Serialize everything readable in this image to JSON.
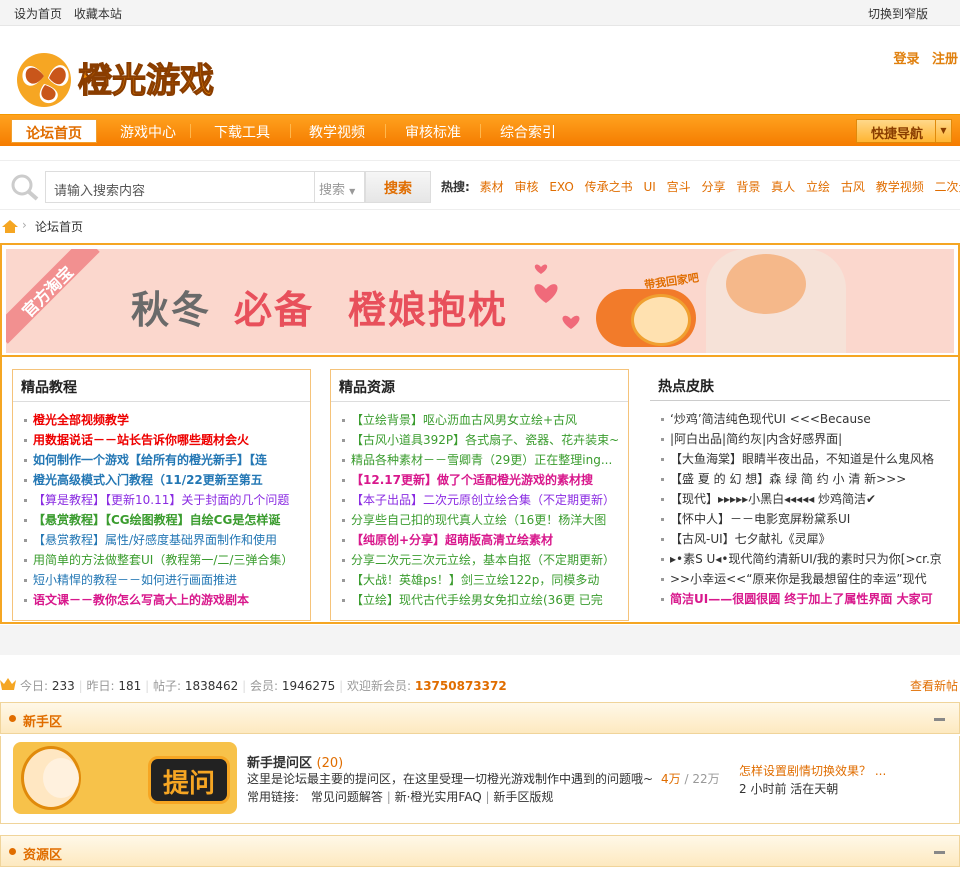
{
  "topbar": {
    "set_home": "设为首页",
    "bookmark": "收藏本站",
    "switch": "切换到窄版"
  },
  "header": {
    "logo_text": "橙光游戏",
    "login": "登录",
    "register": "注册"
  },
  "nav": {
    "items": [
      "论坛首页",
      "游戏中心",
      "下载工具",
      "教学视频",
      "审核标准",
      "综合索引"
    ],
    "quick_nav": "快捷导航"
  },
  "search": {
    "placeholder": "请输入搜索内容",
    "scope": "搜索",
    "button": "搜索",
    "hot_label": "热搜:",
    "hot": [
      "素材",
      "审核",
      "EXO",
      "传承之书",
      "UI",
      "宫斗",
      "分享",
      "背景",
      "真人",
      "立绘",
      "古风",
      "教学视频",
      "二次元"
    ]
  },
  "breadcrumb": {
    "current": "论坛首页"
  },
  "banner": {
    "ribbon": "官方淘宝",
    "text1": "秋冬",
    "text2": "必备",
    "text3": "橙娘抱枕",
    "tag": "带我回家吧"
  },
  "columns": {
    "tutorials": {
      "title": "精品教程",
      "items": [
        {
          "text": "橙光全部视频教学",
          "style": "c-red"
        },
        {
          "text": "用数据说话－－站长告诉你哪些题材会火",
          "style": "c-red"
        },
        {
          "text": "如何制作一个游戏【给所有的橙光新手】【连",
          "style": "c-blueb"
        },
        {
          "text": "橙光高级模式入门教程（11/22更新至第五",
          "style": "c-blueb"
        },
        {
          "text": "【算是教程】【更新10.11】关于封面的几个问题",
          "style": "c-purple"
        },
        {
          "text": "【悬赏教程】【CG绘图教程】自绘CG是怎样诞",
          "style": "c-greenb"
        },
        {
          "text": "【悬赏教程】属性/好感度基础界面制作和使用",
          "style": "c-blue"
        },
        {
          "text": "用简单的方法做整套UI（教程第一/二/三弹合集）",
          "style": "c-green"
        },
        {
          "text": "短小精悍的教程－－如何进行画面推进",
          "style": "c-blue"
        },
        {
          "text": "语文课－－教你怎么写高大上的游戏剧本",
          "style": "c-pink"
        }
      ]
    },
    "resources": {
      "title": "精品资源",
      "items": [
        {
          "text": "【立绘背景】呕心沥血古风男女立绘+古风",
          "style": "c-green"
        },
        {
          "text": "【古风小道具392P】各式扇子、瓷器、花卉装束~",
          "style": "c-green"
        },
        {
          "text": "精品各种素材－－雪卿青（29更）正在整理ing...",
          "style": "c-green"
        },
        {
          "text": "【12.17更新】做了个适配橙光游戏的素材搜",
          "style": "c-pink"
        },
        {
          "text": "【本子出品】二次元原创立绘合集（不定期更新）",
          "style": "c-purple"
        },
        {
          "text": "分享些自己扣的现代真人立绘（16更！杨洋大图",
          "style": "c-green"
        },
        {
          "text": "【纯原创+分享】超萌版高清立绘素材",
          "style": "c-pink"
        },
        {
          "text": "分享二次元三次元立绘，基本自抠（不定期更新）",
          "style": "c-green"
        },
        {
          "text": "【大战！英雄ps！】剑三立绘122p，同模多动",
          "style": "c-green"
        },
        {
          "text": "【立绘】现代古代手绘男女免扣立绘(36更 已完",
          "style": "c-green"
        }
      ]
    },
    "skins": {
      "title": "热点皮肤",
      "items": [
        {
          "text": "‘炒鸡’简洁纯色现代UI <<<Because",
          "style": "c-dark"
        },
        {
          "text": "|阿白出品|简约灰|内含好感界面|",
          "style": "c-dark"
        },
        {
          "text": "【大鱼海棠】眼睛半夜出品，不知道是什么鬼风格",
          "style": "c-dark"
        },
        {
          "text": "【盛 夏 的 幻 想】森 绿 简 约 小 清 新>>>",
          "style": "c-dark"
        },
        {
          "text": "【现代】▸▸▸▸▸小黑白◂◂◂◂◂ 炒鸡简洁✔",
          "style": "c-dark"
        },
        {
          "text": "【怀中人】－－电影宽屏粉黛系UI",
          "style": "c-dark"
        },
        {
          "text": "【古风-UI】七夕献礼《灵犀》",
          "style": "c-dark"
        },
        {
          "text": "▸•素S U◂•现代简约清新UI/我的素时只为你[>cr.京",
          "style": "c-dark"
        },
        {
          "text": ">>小幸运<<“原来你是我最想留住的幸运”现代",
          "style": "c-dark"
        },
        {
          "text": "简洁UI——很圆很圆  终于加上了属性界面  大家可",
          "style": "c-pink"
        }
      ]
    }
  },
  "stats": {
    "today_label": "今日:",
    "today": "233",
    "yesterday_label": "昨日:",
    "yesterday": "181",
    "posts_label": "帖子:",
    "posts": "1838462",
    "members_label": "会员:",
    "members": "1946275",
    "welcome_label": "欢迎新会员:",
    "new_member": "13750873372",
    "view_new": "查看新帖"
  },
  "sections": {
    "newbie": {
      "title": "新手区"
    },
    "resource": {
      "title": "资源区"
    }
  },
  "forum": {
    "image_text": "提问",
    "name": "新手提问区",
    "count": "(20)",
    "desc": "这里是论坛最主要的提问区，在这里受理一切橙光游戏制作中遇到的问题哦~",
    "topics": "4万",
    "posts": "22万",
    "links_label": "常用链接:",
    "links": [
      "常见问题解答",
      "新·橙光实用FAQ",
      "新手区版规"
    ],
    "last_title": "怎样设置剧情切换效果？ ...",
    "last_time": "2 小时前",
    "last_user": "活在天朝"
  }
}
